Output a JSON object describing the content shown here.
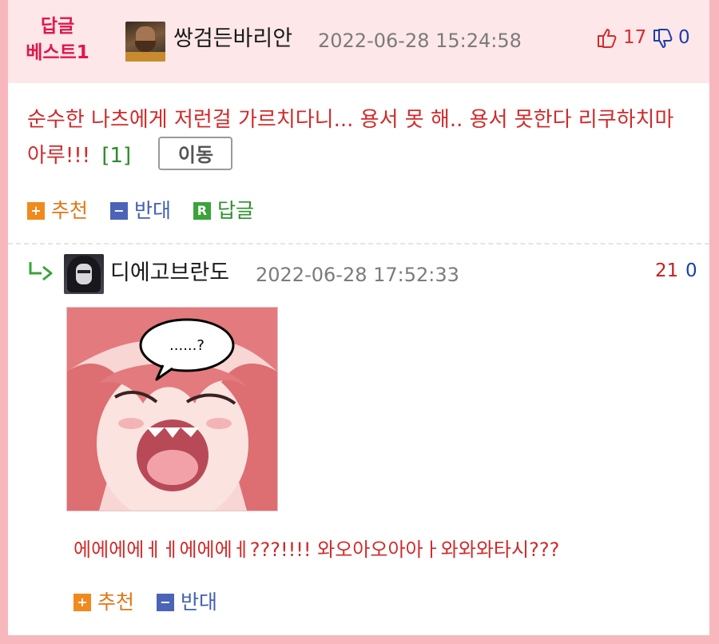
{
  "best_reply": {
    "badge_line1": "답글",
    "badge_line2": "베스트1",
    "author": "쌍검든바리안",
    "timestamp": "2022-06-28 15:24:58",
    "upvotes": "17",
    "downvotes": "0",
    "text": "순수한 나츠에게 저런걸 가르치다니... 용서 못 해.. 용서 못한다 리쿠하치마 아루!!!",
    "ref": "[1]",
    "move_label": "이동",
    "actions": {
      "recommend": "추천",
      "oppose": "반대",
      "reply": "답글"
    }
  },
  "reply": {
    "author": "디에고브란도",
    "timestamp": "2022-06-28 17:52:33",
    "upvotes": "21",
    "downvotes": "0",
    "image_bubble": "......?",
    "text": "에에에에ㅔㅔ에에에ㅔ???!!!! 와오아오아아ㅏ와와와타시???",
    "actions": {
      "recommend": "추천",
      "oppose": "반대"
    }
  },
  "colors": {
    "page_bg": "#f8b7bd",
    "header_bg": "#fde7e9",
    "badge": "#e0174c",
    "comment_text": "#d12a2a",
    "upvote": "#d62b2b",
    "downvote": "#1c3fa8"
  },
  "icons": {
    "upvote": "thumbs-up-icon",
    "downvote": "thumbs-down-icon",
    "reply_arrow": "reply-arrow-icon",
    "recommend": "plus-square-icon",
    "oppose": "minus-square-icon",
    "reply": "r-square-icon"
  }
}
